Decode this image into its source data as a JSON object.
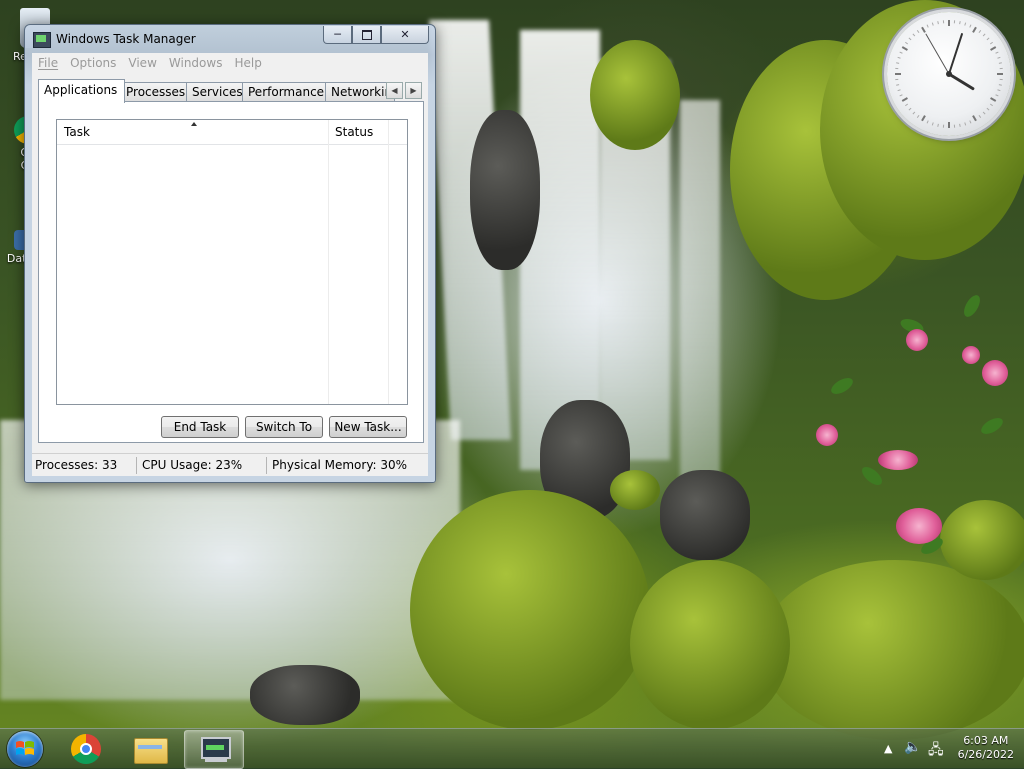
{
  "desktop": {
    "icons": [
      {
        "label": "Re",
        "name": "recycle-bin"
      },
      {
        "label": "Go",
        "label2": "Ch",
        "name": "google-chrome"
      },
      {
        "label": "Data",
        "name": "data-folder"
      }
    ]
  },
  "clock": {
    "hour": 4,
    "minute": 3,
    "second": 55
  },
  "window": {
    "title": "Windows Task Manager",
    "menu": [
      "File",
      "Options",
      "View",
      "Windows",
      "Help"
    ],
    "tabs": [
      "Applications",
      "Processes",
      "Services",
      "Performance",
      "Networking"
    ],
    "active_tab": "Applications",
    "list": {
      "columns": [
        "Task",
        "Status"
      ],
      "rows": []
    },
    "buttons": {
      "end_task": "End Task",
      "switch_to": "Switch To",
      "new_task": "New Task..."
    },
    "status": {
      "processes": "Processes: 33",
      "cpu": "CPU Usage: 23%",
      "memory": "Physical Memory: 30%"
    }
  },
  "taskbar": {
    "pinned": [
      "start",
      "chrome",
      "windows-explorer",
      "task-manager"
    ],
    "active": "task-manager",
    "time": "6:03 AM",
    "date": "6/26/2022"
  },
  "colors": {
    "window_frame": "#c6d4e3",
    "menu_disabled_text": "#9a9a9a",
    "taskbar": "#3c5a3c"
  }
}
